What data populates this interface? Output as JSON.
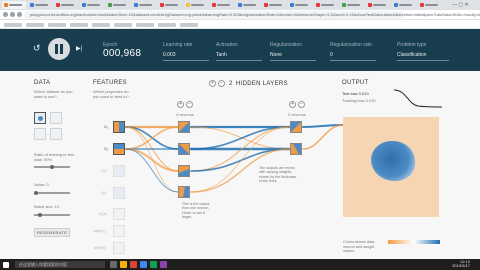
{
  "browser": {
    "url": "playground.tensorflow.org/#activation=tanh&batchSize=10&dataset=circle&regDataset=reg-plane&learningRate=0.003&regularizationRate=0&noise=0&networkShape=4,2&seed=0.15&showTestData=false&discretize=false&percTrainData=50&x=true&y=true"
  },
  "controls": {
    "epoch_label": "Epoch",
    "epoch_value": "000,968",
    "learning_rate_label": "Learning rate",
    "learning_rate_value": "0.003",
    "activation_label": "Activation",
    "activation_value": "Tanh",
    "regularization_label": "Regularization",
    "regularization_value": "None",
    "reg_rate_label": "Regularization rate",
    "reg_rate_value": "0",
    "problem_type_label": "Problem type",
    "problem_type_value": "Classification"
  },
  "data_panel": {
    "title": "DATA",
    "question": "Which dataset do you want to use?",
    "ratio_label": "Ratio of training to test data:  50%",
    "noise_label": "Noise:  0",
    "batch_label": "Batch size:  10",
    "regenerate": "REGENERATE"
  },
  "features_panel": {
    "title": "FEATURES",
    "question": "Which properties do you want to feed in?",
    "labels": [
      "X₁",
      "X₂",
      "X₁²",
      "X₂²",
      "X₁X₂",
      "sin(X₁)",
      "sin(X₂)"
    ]
  },
  "hidden": {
    "count": "2",
    "title": "HIDDEN LAYERS",
    "layer1_label": "4 neurons",
    "layer2_label": "2 neurons",
    "note_outputs": "The outputs are mixed with varying weights, shown by the thickness of the lines.",
    "note_output": "This is the output from one neuron. Hover to see it larger."
  },
  "output": {
    "title": "OUTPUT",
    "test_loss": "Test loss 0.010",
    "training_loss": "Training loss 0.010",
    "legend_text": "Colors shows data, neuron and weight values.",
    "colors": {
      "negative": "#f09a45",
      "positive": "#1f6fb0"
    }
  },
  "taskbar": {
    "search_placeholder": "在这里输入你要搜索的内容",
    "time": "12:12",
    "date": "2019/5/17"
  }
}
